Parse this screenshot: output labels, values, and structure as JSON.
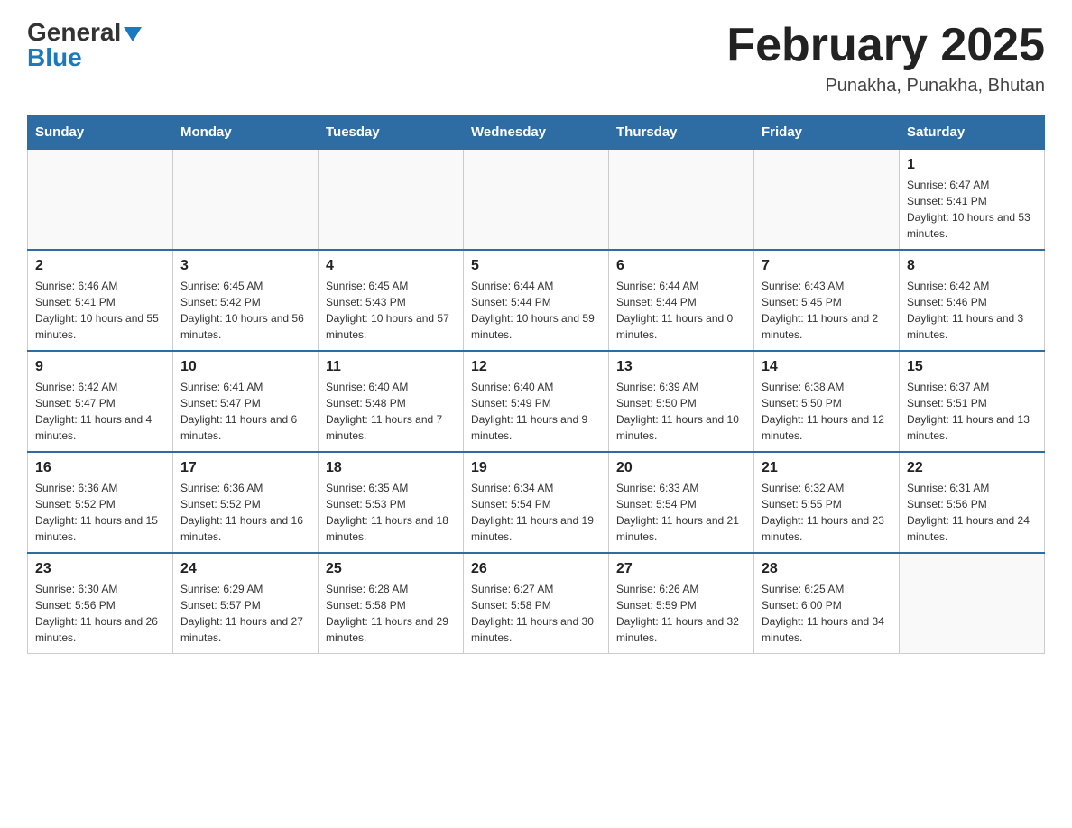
{
  "header": {
    "logo_general": "General",
    "logo_blue": "Blue",
    "main_title": "February 2025",
    "subtitle": "Punakha, Punakha, Bhutan"
  },
  "days_of_week": [
    "Sunday",
    "Monday",
    "Tuesday",
    "Wednesday",
    "Thursday",
    "Friday",
    "Saturday"
  ],
  "weeks": [
    [
      {
        "day": "",
        "info": ""
      },
      {
        "day": "",
        "info": ""
      },
      {
        "day": "",
        "info": ""
      },
      {
        "day": "",
        "info": ""
      },
      {
        "day": "",
        "info": ""
      },
      {
        "day": "",
        "info": ""
      },
      {
        "day": "1",
        "info": "Sunrise: 6:47 AM\nSunset: 5:41 PM\nDaylight: 10 hours and 53 minutes."
      }
    ],
    [
      {
        "day": "2",
        "info": "Sunrise: 6:46 AM\nSunset: 5:41 PM\nDaylight: 10 hours and 55 minutes."
      },
      {
        "day": "3",
        "info": "Sunrise: 6:45 AM\nSunset: 5:42 PM\nDaylight: 10 hours and 56 minutes."
      },
      {
        "day": "4",
        "info": "Sunrise: 6:45 AM\nSunset: 5:43 PM\nDaylight: 10 hours and 57 minutes."
      },
      {
        "day": "5",
        "info": "Sunrise: 6:44 AM\nSunset: 5:44 PM\nDaylight: 10 hours and 59 minutes."
      },
      {
        "day": "6",
        "info": "Sunrise: 6:44 AM\nSunset: 5:44 PM\nDaylight: 11 hours and 0 minutes."
      },
      {
        "day": "7",
        "info": "Sunrise: 6:43 AM\nSunset: 5:45 PM\nDaylight: 11 hours and 2 minutes."
      },
      {
        "day": "8",
        "info": "Sunrise: 6:42 AM\nSunset: 5:46 PM\nDaylight: 11 hours and 3 minutes."
      }
    ],
    [
      {
        "day": "9",
        "info": "Sunrise: 6:42 AM\nSunset: 5:47 PM\nDaylight: 11 hours and 4 minutes."
      },
      {
        "day": "10",
        "info": "Sunrise: 6:41 AM\nSunset: 5:47 PM\nDaylight: 11 hours and 6 minutes."
      },
      {
        "day": "11",
        "info": "Sunrise: 6:40 AM\nSunset: 5:48 PM\nDaylight: 11 hours and 7 minutes."
      },
      {
        "day": "12",
        "info": "Sunrise: 6:40 AM\nSunset: 5:49 PM\nDaylight: 11 hours and 9 minutes."
      },
      {
        "day": "13",
        "info": "Sunrise: 6:39 AM\nSunset: 5:50 PM\nDaylight: 11 hours and 10 minutes."
      },
      {
        "day": "14",
        "info": "Sunrise: 6:38 AM\nSunset: 5:50 PM\nDaylight: 11 hours and 12 minutes."
      },
      {
        "day": "15",
        "info": "Sunrise: 6:37 AM\nSunset: 5:51 PM\nDaylight: 11 hours and 13 minutes."
      }
    ],
    [
      {
        "day": "16",
        "info": "Sunrise: 6:36 AM\nSunset: 5:52 PM\nDaylight: 11 hours and 15 minutes."
      },
      {
        "day": "17",
        "info": "Sunrise: 6:36 AM\nSunset: 5:52 PM\nDaylight: 11 hours and 16 minutes."
      },
      {
        "day": "18",
        "info": "Sunrise: 6:35 AM\nSunset: 5:53 PM\nDaylight: 11 hours and 18 minutes."
      },
      {
        "day": "19",
        "info": "Sunrise: 6:34 AM\nSunset: 5:54 PM\nDaylight: 11 hours and 19 minutes."
      },
      {
        "day": "20",
        "info": "Sunrise: 6:33 AM\nSunset: 5:54 PM\nDaylight: 11 hours and 21 minutes."
      },
      {
        "day": "21",
        "info": "Sunrise: 6:32 AM\nSunset: 5:55 PM\nDaylight: 11 hours and 23 minutes."
      },
      {
        "day": "22",
        "info": "Sunrise: 6:31 AM\nSunset: 5:56 PM\nDaylight: 11 hours and 24 minutes."
      }
    ],
    [
      {
        "day": "23",
        "info": "Sunrise: 6:30 AM\nSunset: 5:56 PM\nDaylight: 11 hours and 26 minutes."
      },
      {
        "day": "24",
        "info": "Sunrise: 6:29 AM\nSunset: 5:57 PM\nDaylight: 11 hours and 27 minutes."
      },
      {
        "day": "25",
        "info": "Sunrise: 6:28 AM\nSunset: 5:58 PM\nDaylight: 11 hours and 29 minutes."
      },
      {
        "day": "26",
        "info": "Sunrise: 6:27 AM\nSunset: 5:58 PM\nDaylight: 11 hours and 30 minutes."
      },
      {
        "day": "27",
        "info": "Sunrise: 6:26 AM\nSunset: 5:59 PM\nDaylight: 11 hours and 32 minutes."
      },
      {
        "day": "28",
        "info": "Sunrise: 6:25 AM\nSunset: 6:00 PM\nDaylight: 11 hours and 34 minutes."
      },
      {
        "day": "",
        "info": ""
      }
    ]
  ]
}
